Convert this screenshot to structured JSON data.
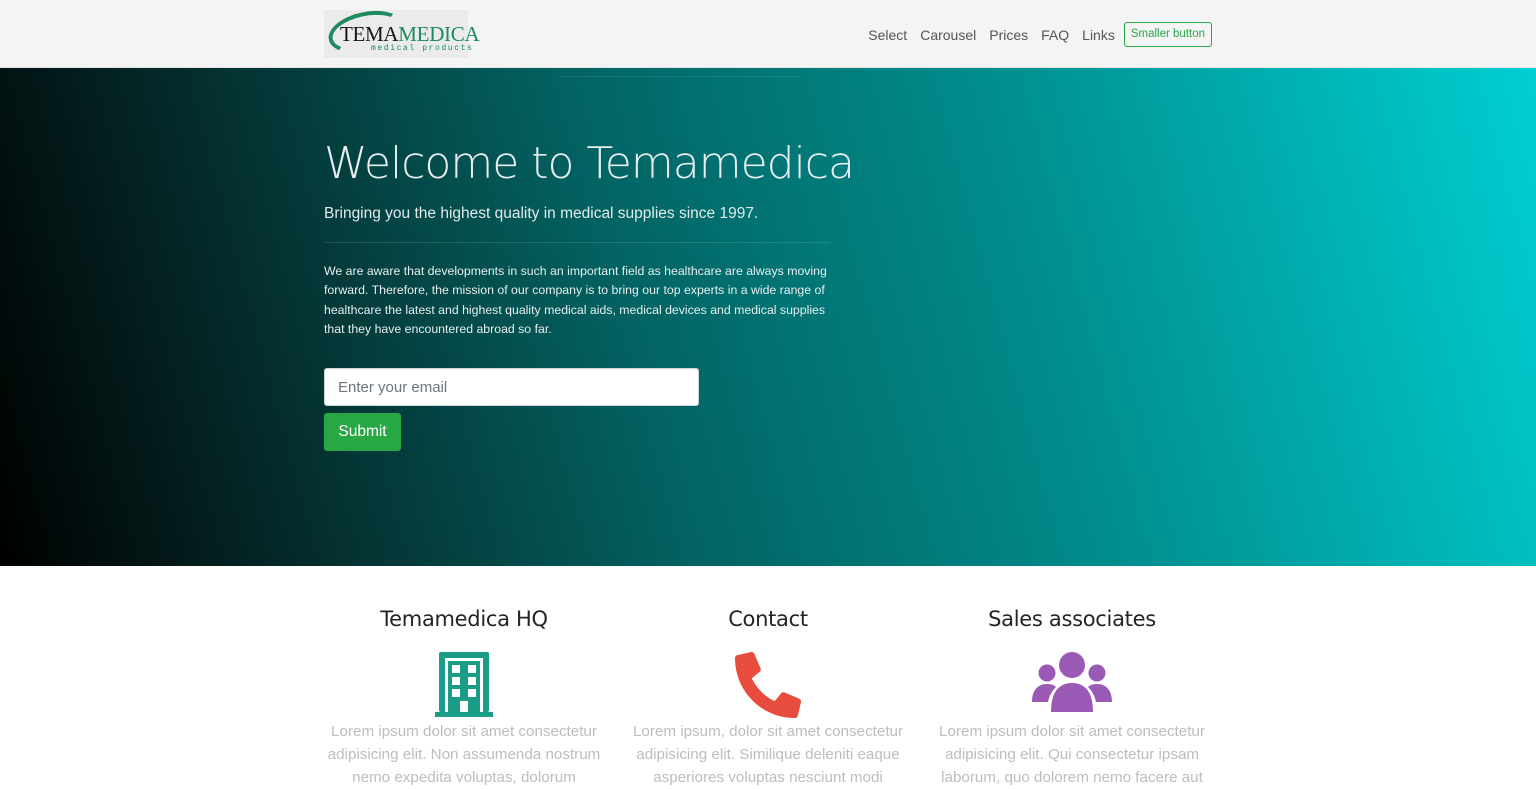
{
  "navbar": {
    "logo": {
      "text_main_a": "TEMA",
      "text_main_b": "MEDICA",
      "text_sub": "medical products"
    },
    "links": [
      "Select",
      "Carousel",
      "Prices",
      "FAQ",
      "Links"
    ],
    "button_label": "Smaller button"
  },
  "hero": {
    "title": "Welcome to Temamedica",
    "lead": "Bringing you the highest quality in medical supplies since 1997.",
    "body": "We are aware that developments in such an important field as healthcare are always moving forward. Therefore, the mission of our company is to bring our top experts in a wide range of healthcare the latest and highest quality medical aids, medical devices and medical supplies that they have encountered abroad so far.",
    "email_placeholder": "Enter your email",
    "submit_label": "Submit",
    "gradient_colors": [
      "#000000",
      "#036363",
      "#00cfd2"
    ]
  },
  "features": [
    {
      "title": "Temamedica HQ",
      "icon": "building-icon",
      "icon_color": "#1a9c87",
      "text": "Lorem ipsum dolor sit amet consectetur adipisicing elit. Non assumenda nostrum nemo expedita voluptas, dolorum"
    },
    {
      "title": "Contact",
      "icon": "phone-icon",
      "icon_color": "#e74c3c",
      "text": "Lorem ipsum, dolor sit amet consectetur adipisicing elit. Similique deleniti eaque asperiores voluptas nesciunt modi"
    },
    {
      "title": "Sales associates",
      "icon": "users-icon",
      "icon_color": "#9b59b6",
      "text": "Lorem ipsum dolor sit amet consectetur adipisicing elit. Qui consectetur ipsam laborum, quo dolorem nemo facere aut"
    }
  ],
  "colors": {
    "accent_green": "#28a745",
    "navbar_bg": "#f4f4f4"
  }
}
